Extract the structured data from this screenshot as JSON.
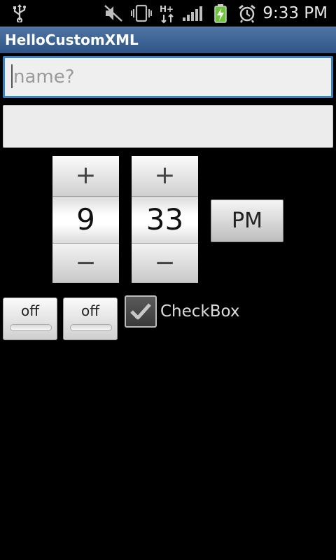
{
  "status_bar": {
    "time": "9:33 PM",
    "icons": [
      "usb-icon",
      "mute-icon",
      "vibrate-icon",
      "hspa-plus-icon",
      "signal-icon",
      "battery-charging-icon",
      "alarm-icon"
    ],
    "network_label": "H+"
  },
  "app": {
    "title": "HelloCustomXML"
  },
  "name_input": {
    "placeholder": "name?",
    "value": ""
  },
  "second_input": {
    "value": ""
  },
  "time_picker": {
    "hour": "9",
    "minute": "33",
    "increment_symbol": "+",
    "decrement_symbol": "−",
    "ampm": "PM"
  },
  "toggles": [
    {
      "label": "off",
      "checked": false
    },
    {
      "label": "off",
      "checked": false
    }
  ],
  "checkbox": {
    "label": "CheckBox",
    "checked": true
  },
  "colors": {
    "title_bar": "#3e6595",
    "focus_border": "#3d83c2",
    "battery_green": "#6ec43a",
    "background": "#000000"
  }
}
